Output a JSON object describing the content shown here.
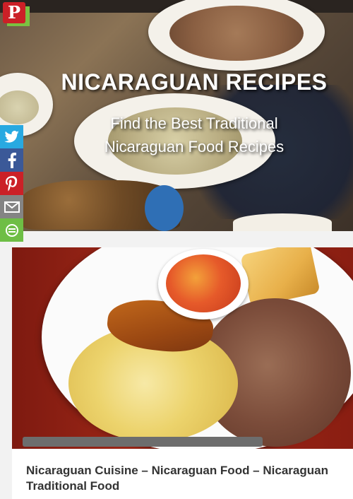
{
  "hero": {
    "title": "NICARAGUAN RECIPES",
    "subtitle": "Find the Best Traditional Nicaraguan Food Recipes"
  },
  "badge": {
    "icon": "pinterest-icon",
    "glyph": "P"
  },
  "share_bar": [
    {
      "name": "twitter",
      "icon": "twitter-icon",
      "color": "#28a9e1"
    },
    {
      "name": "facebook",
      "icon": "facebook-icon",
      "color": "#3b5998"
    },
    {
      "name": "pinterest",
      "icon": "pinterest-icon",
      "color": "#cb2027"
    },
    {
      "name": "email",
      "icon": "email-icon",
      "color": "#848484"
    },
    {
      "name": "more",
      "icon": "share-more-icon",
      "color": "#6ebe45"
    }
  ],
  "article": {
    "title": "Nicaraguan Cuisine – Nicaraguan Food – Nicaraguan Traditional Food"
  }
}
